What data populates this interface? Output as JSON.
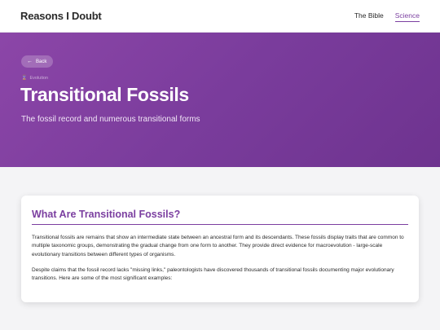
{
  "header": {
    "brand": "Reasons I Doubt",
    "nav": [
      {
        "label": "The Bible",
        "active": false
      },
      {
        "label": "Science",
        "active": true
      }
    ]
  },
  "hero": {
    "back_label": "Back",
    "category": "Evolution",
    "title": "Transitional Fossils",
    "subtitle": "The fossil record and numerous transitional forms",
    "colors": {
      "gradient_start": "#8c46a8",
      "gradient_end": "#6e338f"
    }
  },
  "article": {
    "heading": "What Are Transitional Fossils?",
    "paragraphs": [
      "Transitional fossils are remains that show an intermediate state between an ancestral form and its descendants. These fossils display traits that are common to multiple taxonomic groups, demonstrating the gradual change from one form to another. They provide direct evidence for macroevolution - large-scale evolutionary transitions between different types of organisms.",
      "Despite claims that the fossil record lacks \"missing links,\" paleontologists have discovered thousands of transitional fossils documenting major evolutionary transitions. Here are some of the most significant examples:"
    ],
    "accent_color": "#7b3fa0"
  }
}
